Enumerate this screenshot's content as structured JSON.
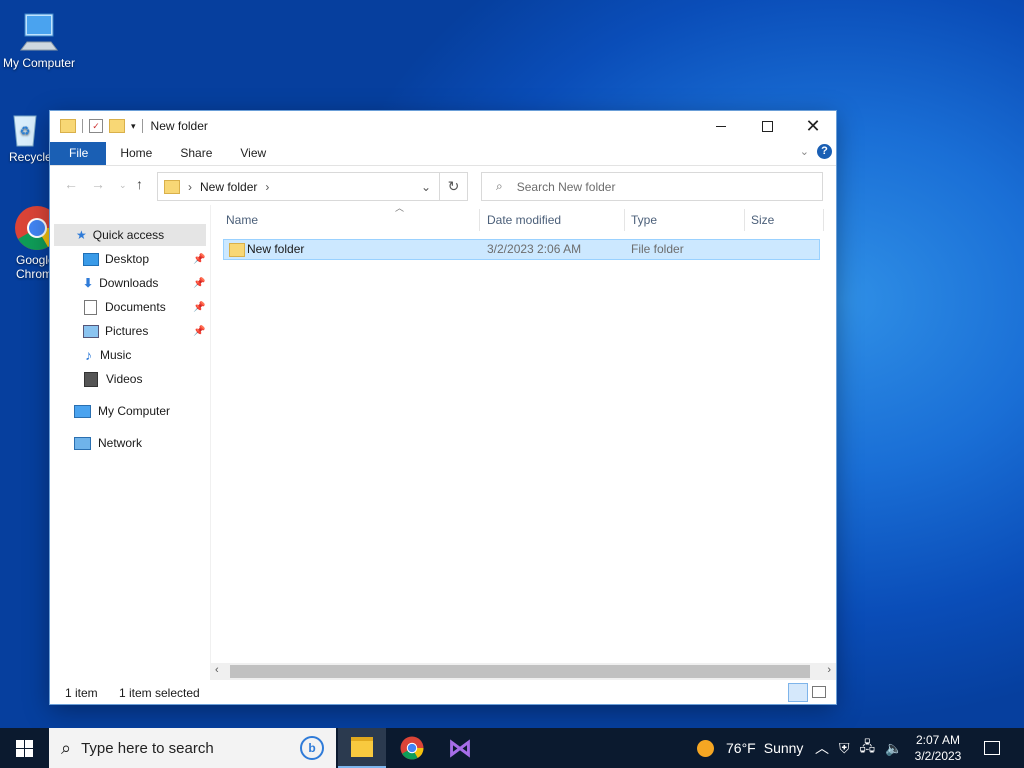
{
  "desktop": {
    "icons": [
      {
        "label": "My Computer"
      },
      {
        "label": "Recycle"
      },
      {
        "label": "Google Chrome"
      }
    ]
  },
  "window": {
    "title": "New folder",
    "ribbon_tabs": [
      "File",
      "Home",
      "Share",
      "View"
    ],
    "address": {
      "path": "New folder"
    },
    "search": {
      "placeholder": "Search New folder"
    },
    "nav": {
      "quick_access": "Quick access",
      "pinned": [
        "Desktop",
        "Downloads",
        "Documents",
        "Pictures"
      ],
      "others": [
        "Music",
        "Videos"
      ],
      "my_computer": "My Computer",
      "network": "Network"
    },
    "columns": [
      "Name",
      "Date modified",
      "Type",
      "Size"
    ],
    "rows": [
      {
        "name": "New folder",
        "date": "3/2/2023 2:06 AM",
        "type": "File folder",
        "size": ""
      }
    ],
    "status": {
      "count": "1 item",
      "selected": "1 item selected"
    }
  },
  "taskbar": {
    "search_placeholder": "Type here to search",
    "weather": {
      "temp": "76°F",
      "condition": "Sunny"
    },
    "clock": {
      "time": "2:07 AM",
      "date": "3/2/2023"
    }
  },
  "colors": {
    "accent": "#1a5fb4",
    "selection": "#cce8ff",
    "taskbar": "#0b1a2f"
  }
}
